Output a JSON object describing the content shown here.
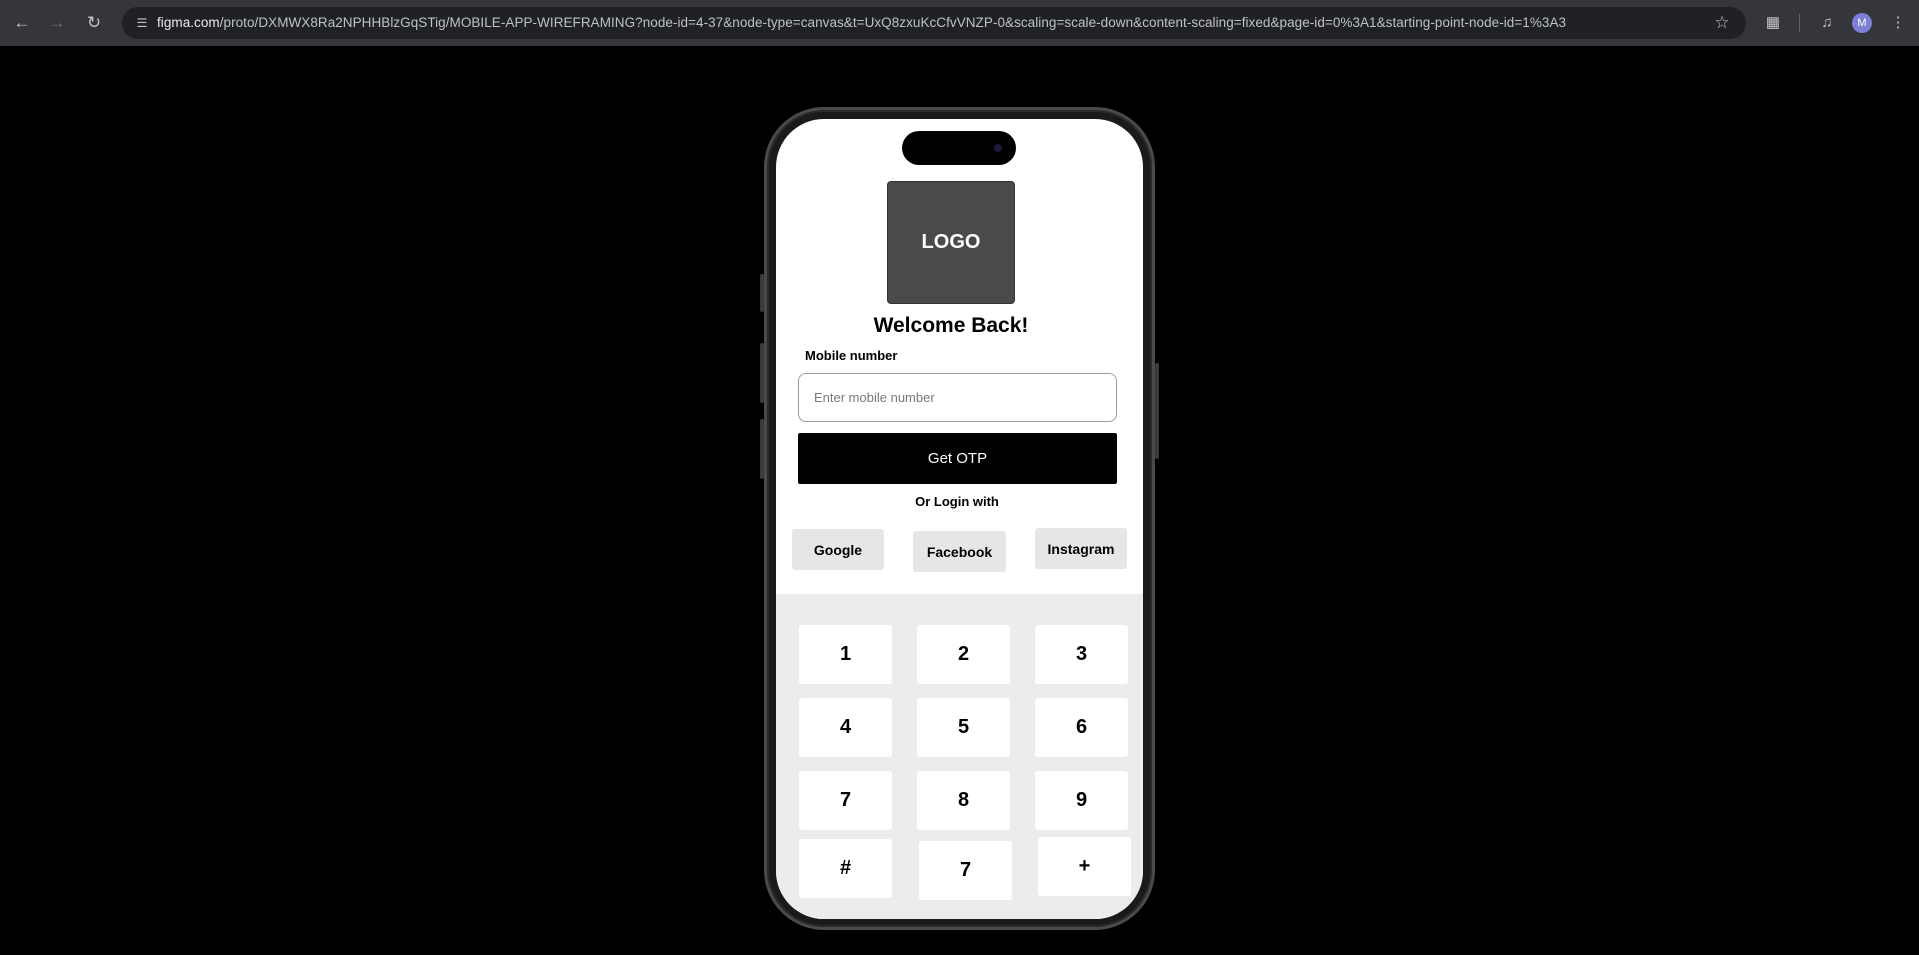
{
  "browser": {
    "url_host": "figma.com",
    "url_path": "/proto/DXMWX8Ra2NPHHBlzGqSTig/MOBILE-APP-WIREFRAMING?node-id=4-37&node-type=canvas&t=UxQ8zxuKcCfvVNZP-0&scaling=scale-down&content-scaling=fixed&page-id=0%3A1&starting-point-node-id=1%3A3",
    "profile_initial": "M"
  },
  "app": {
    "logo_text": "LOGO",
    "heading": "Welcome Back!",
    "mobile_label": "Mobile number",
    "mobile_placeholder": "Enter mobile number",
    "otp_button": "Get OTP",
    "or_login": "Or Login with",
    "social": [
      "Google",
      "Facebook",
      "Instagram"
    ],
    "keypad": [
      "1",
      "2",
      "3",
      "4",
      "5",
      "6",
      "7",
      "8",
      "9",
      "#",
      "7",
      "+"
    ]
  }
}
